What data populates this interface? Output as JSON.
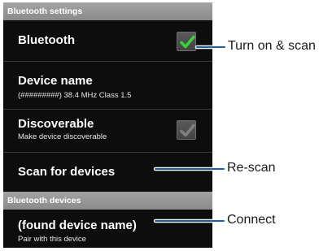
{
  "settings_header": "Bluetooth settings",
  "bluetooth": {
    "title": "Bluetooth",
    "checked": true
  },
  "device_name": {
    "title": "Device name",
    "subtitle": "(#########) 38.4 MHz Class 1.5"
  },
  "discoverable": {
    "title": "Discoverable",
    "subtitle": "Make device discoverable",
    "checked": true
  },
  "scan": {
    "title": "Scan for devices"
  },
  "devices_header": "Bluetooth devices",
  "found_device": {
    "title": "(found device name)",
    "subtitle": "Pair with this device"
  },
  "callouts": {
    "turn_on": "Turn on & scan",
    "rescan": "Re-scan",
    "connect": "Connect"
  },
  "colors": {
    "check_active": "#3cd13c",
    "check_inactive": "#7f7f7f",
    "leader_line": "#1a5fa8",
    "screen_bg": "#0d0d0d",
    "header_bg": "#9a9a9a"
  }
}
